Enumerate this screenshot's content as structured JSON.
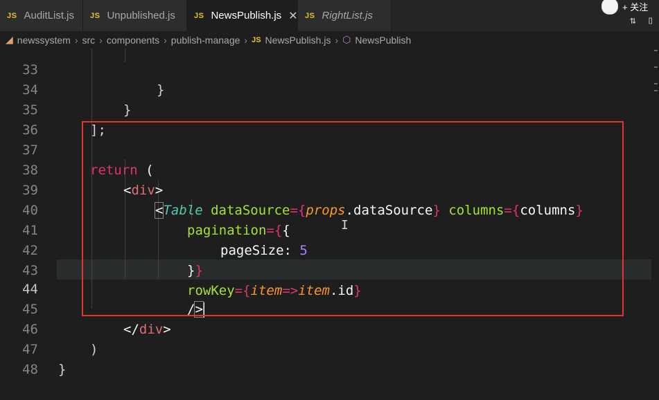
{
  "tabs": [
    {
      "badge": "JS",
      "label": "AuditList.js"
    },
    {
      "badge": "JS",
      "label": "Unpublished.js"
    },
    {
      "badge": "JS",
      "label": "NewsPublish.js",
      "close": "✕"
    },
    {
      "badge": "JS",
      "label": "RightList.js"
    }
  ],
  "follow": {
    "label": "+ 关注"
  },
  "breadcrumb": {
    "items": [
      "newssystem",
      "src",
      "components",
      "publish-manage"
    ],
    "file_badge": "JS",
    "file": "NewsPublish.js",
    "symbol": "NewsPublish",
    "separator": "›"
  },
  "lines": {
    "n33": "33",
    "n34": "34",
    "n35": "35",
    "n36": "36",
    "n37": "37",
    "n38": "38",
    "n39": "39",
    "n40": "40",
    "n41": "41",
    "n42": "42",
    "n43": "43",
    "n44": "44",
    "n45": "45",
    "n46": "46",
    "n47": "47",
    "n48": "48"
  },
  "code": {
    "l33": "}",
    "l34": "}",
    "l35": "];",
    "l37_kw": "return",
    "l37_rest": " (",
    "l38_open": "<",
    "l38_tag": "div",
    "l38_close": ">",
    "l39_lt": "<",
    "l39_comp": "Table",
    "l39_attr1": " dataSource",
    "l39_eq1": "=",
    "l39_b1": "{",
    "l39_prop": "props",
    "l39_dot": ".dataSource",
    "l39_b2": "}",
    "l39_attr2": " columns",
    "l39_eq2": "=",
    "l39_b3": "{",
    "l39_val": "columns",
    "l39_b4": "}",
    "l40_attr": "pagination",
    "l40_eq": "=",
    "l40_b": "{",
    "l40_b2": "{",
    "l41_key": "pageSize: ",
    "l41_num": "5",
    "l42_b1": "}",
    "l42_b2": "}",
    "l43_attr": "rowKey",
    "l43_eq": "=",
    "l43_b1": "{",
    "l43_p1": "item",
    "l43_arrow": "=>",
    "l43_p2": "item",
    "l43_rest": ".id",
    "l43_b2": "}",
    "l44_slash": "/",
    "l44_gt": ">",
    "l45_open": "</",
    "l45_tag": "div",
    "l45_close": ">",
    "l46": ")",
    "l47": "}"
  }
}
